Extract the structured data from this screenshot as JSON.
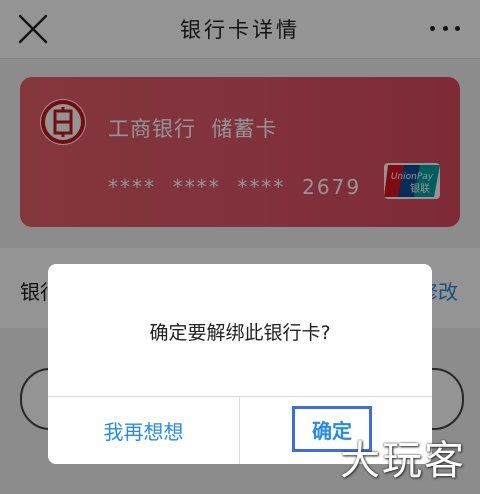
{
  "header": {
    "title": "银行卡详情",
    "close_icon": "close-icon",
    "more_icon": "more-dots-icon"
  },
  "card": {
    "bank_name": "工商银行  储蓄卡",
    "number_mask": "****  ****  ****  2679",
    "bank_logo": "icbc-logo",
    "network_logo": "unionpay-logo",
    "gradient_colors": [
      "#e35d6a",
      "#d94a5e"
    ]
  },
  "info_row": {
    "label": "银行",
    "action": "修改"
  },
  "dialog": {
    "message": "确定要解绑此银行卡?",
    "cancel_label": "我再想想",
    "confirm_label": "确定"
  },
  "watermark": "大玩客",
  "colors": {
    "accent": "#2a8be0",
    "card": "#e0576a",
    "highlight_border": "#3e6fd8"
  }
}
